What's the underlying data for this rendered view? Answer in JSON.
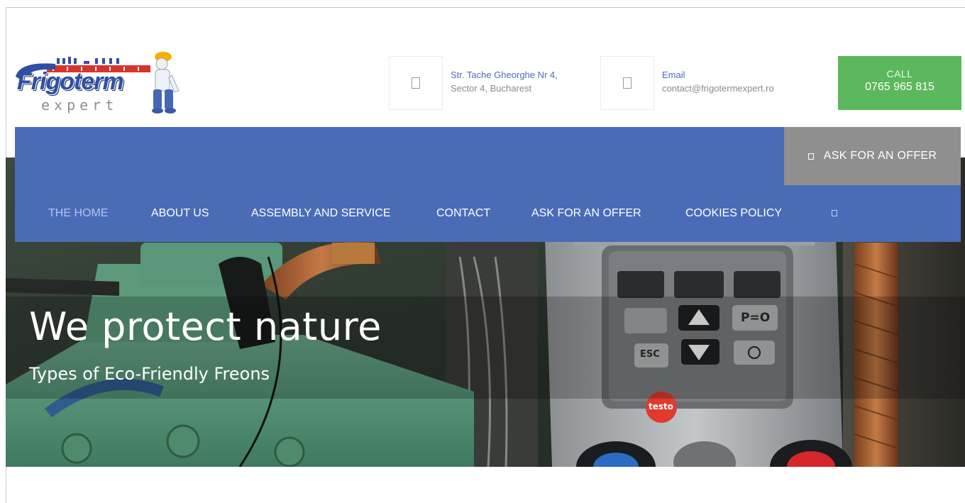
{
  "header": {
    "logo": {
      "word": "Frigoterm",
      "sub": "expert",
      "icon": "worker-mascot-icon"
    },
    "address": {
      "icon": "map-marker-icon",
      "line1": "Str. Tache Gheorghe Nr 4,",
      "line2": "Sector 4, Bucharest"
    },
    "email": {
      "icon": "envelope-icon",
      "label": "Email",
      "value": "contact@frigotermexpert.ro"
    },
    "call": {
      "label": "CALL",
      "number": "0765 965 815"
    }
  },
  "offer_button": {
    "icon": "pencil-icon",
    "label": "ASK FOR AN OFFER"
  },
  "nav": {
    "items": [
      {
        "label": "THE HOME",
        "active": true
      },
      {
        "label": "ABOUT US"
      },
      {
        "label": "ASSEMBLY AND SERVICE"
      },
      {
        "label": "CONTACT"
      },
      {
        "label": "ASK FOR AN OFFER"
      },
      {
        "label": "COOKIES POLICY"
      }
    ],
    "search_icon": "search-icon"
  },
  "hero": {
    "title": "We protect nature",
    "subtitle": "Types of Eco-Friendly Freons",
    "gauge_keys": [
      "",
      "",
      "",
      "",
      "",
      "P=O",
      "ESC",
      "",
      ""
    ],
    "brand_badge": "testo"
  },
  "colors": {
    "nav_blue": "#4a6cb7",
    "call_green": "#5cb85c",
    "offer_gray": "#8f8f8f",
    "link_blue": "#4a6cb9"
  }
}
